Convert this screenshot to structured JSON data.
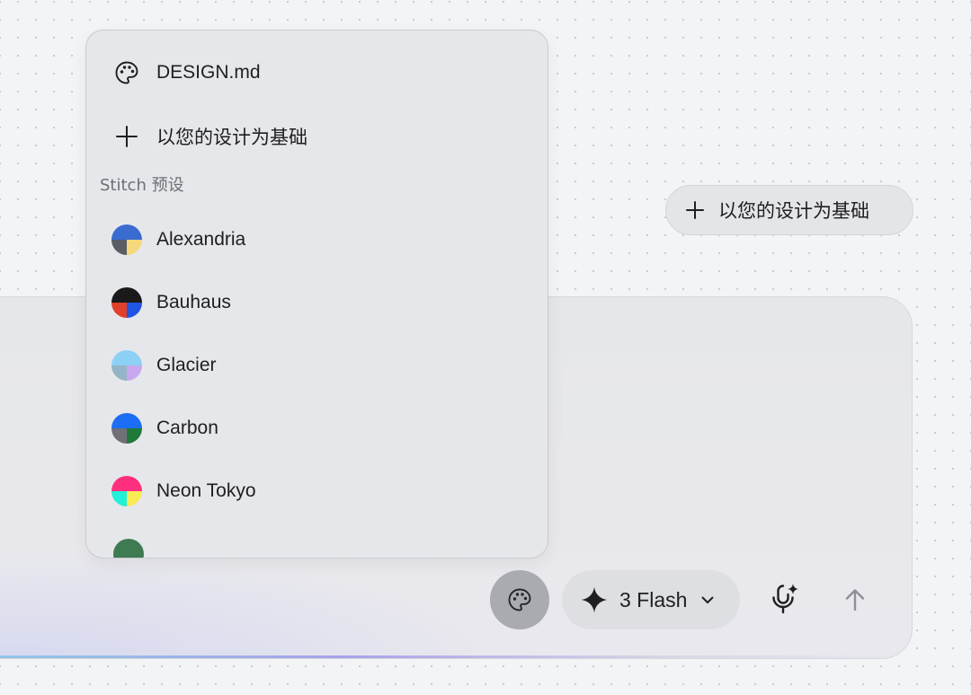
{
  "popover": {
    "design_md": {
      "label": "DESIGN.md",
      "icon": "palette-icon"
    },
    "base_on_design": {
      "label": "以您的设计为基础",
      "icon": "plus-icon"
    },
    "section_title": "Stitch 预设",
    "presets": [
      {
        "label": "Alexandria",
        "colors": [
          "#3a6bd1",
          "#5a5d64",
          "#f5d97a"
        ]
      },
      {
        "label": "Bauhaus",
        "colors": [
          "#1a1a1a",
          "#e0402a",
          "#1f55e0"
        ]
      },
      {
        "label": "Glacier",
        "colors": [
          "#8dd0f5",
          "#96b4c8",
          "#c7a8ee"
        ]
      },
      {
        "label": "Carbon",
        "colors": [
          "#1b6ef5",
          "#6f7176",
          "#1f7a3a"
        ]
      },
      {
        "label": "Neon Tokyo",
        "colors": [
          "#ff2e7e",
          "#22f0d8",
          "#f7ea55"
        ]
      }
    ],
    "partial_preset_color": "#3e7a52"
  },
  "chip": {
    "label": "以您的设计为基础",
    "icon": "plus-icon"
  },
  "toolbar": {
    "palette_button": {
      "icon": "palette-icon"
    },
    "model_selector": {
      "label": "3 Flash",
      "icon": "sparkle-icon",
      "chevron": "chevron-down-icon"
    },
    "mic_button": {
      "icon": "mic-sparkle-icon"
    },
    "send_button": {
      "icon": "arrow-up-icon"
    }
  }
}
